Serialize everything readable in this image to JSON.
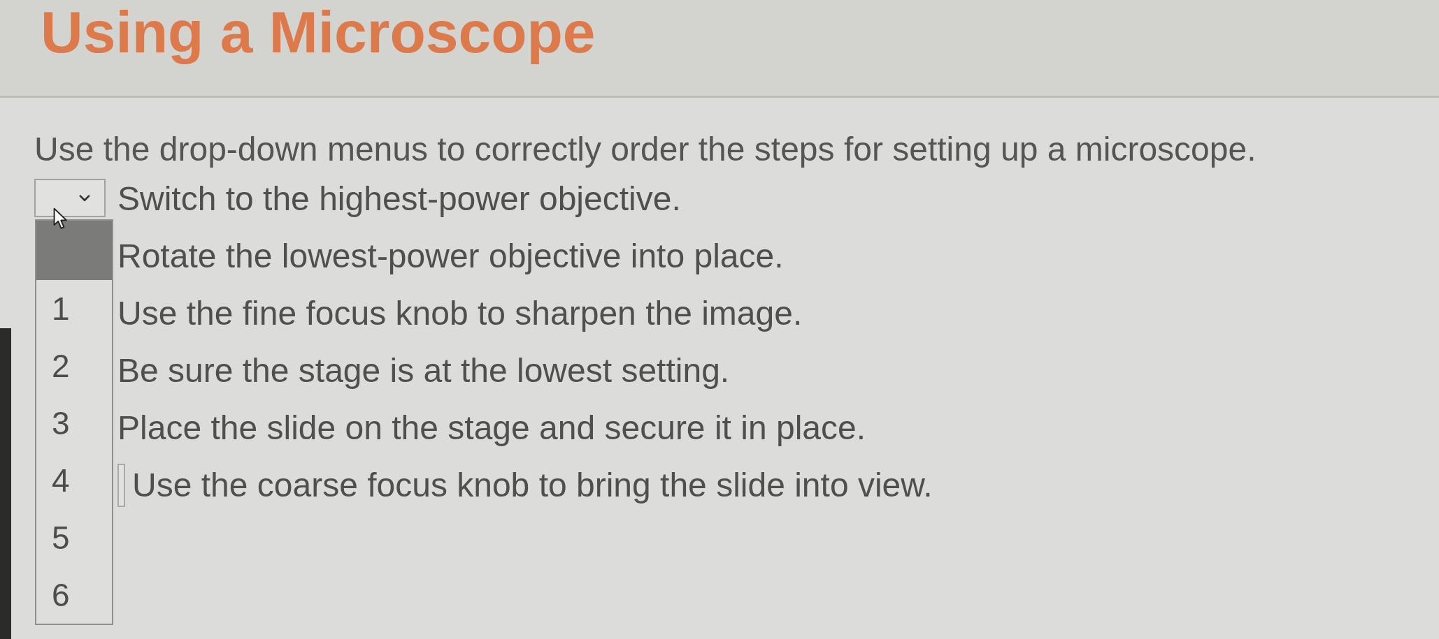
{
  "page_title": "Using a Microscope",
  "instructions": "Use the drop-down menus to correctly order the steps for setting up a microscope.",
  "steps": [
    {
      "text": "Switch to the highest-power objective.",
      "kind": "dropdown",
      "expanded": true
    },
    {
      "text": "Rotate the lowest-power objective into place.",
      "kind": "covered"
    },
    {
      "text": "Use the fine focus knob to sharpen the image.",
      "kind": "covered"
    },
    {
      "text": "Be sure the stage is at the lowest setting.",
      "kind": "covered"
    },
    {
      "text": "Place the slide on the stage and secure it in place.",
      "kind": "covered"
    },
    {
      "text": "Use the coarse focus knob to bring the slide into view.",
      "kind": "edge"
    }
  ],
  "dropdown_options": [
    {
      "kind": "blank",
      "selected": true
    },
    {
      "kind": "number",
      "label": "1",
      "selected": false
    },
    {
      "kind": "number",
      "label": "2",
      "selected": false
    },
    {
      "kind": "number",
      "label": "3",
      "selected": false
    },
    {
      "kind": "number",
      "label": "4",
      "selected": false
    },
    {
      "kind": "number",
      "label": "5",
      "selected": false
    },
    {
      "kind": "number",
      "label": "6",
      "selected": false
    }
  ]
}
